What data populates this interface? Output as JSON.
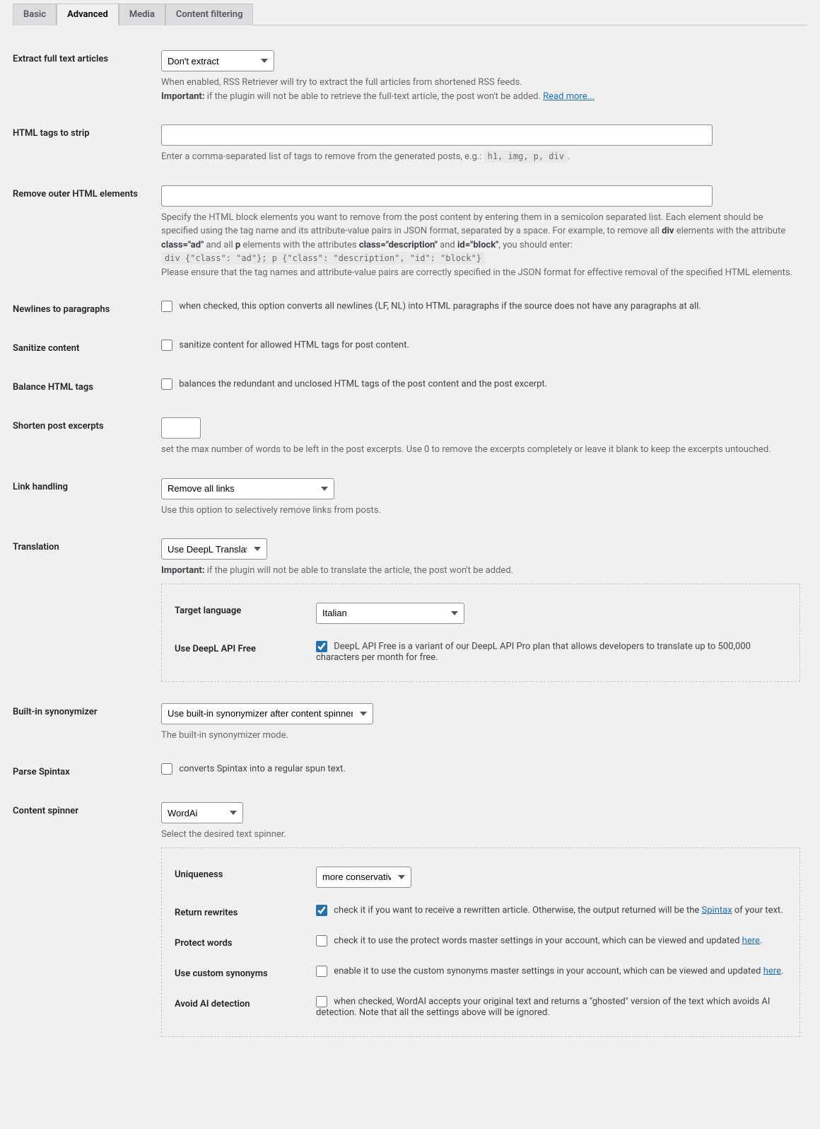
{
  "tabs": {
    "basic": "Basic",
    "advanced": "Advanced",
    "media": "Media",
    "content_filtering": "Content filtering"
  },
  "extract": {
    "label": "Extract full text articles",
    "value": "Don't extract",
    "desc1": "When enabled, RSS Retriever will try to extract the full articles from shortened RSS feeds.",
    "imp": "Important:",
    "desc2": " if the plugin will not be able to retrieve the full-text article, the post won't be added. ",
    "link": "Read more..."
  },
  "strip": {
    "label": "HTML tags to strip",
    "desc_a": "Enter a comma-separated list of tags to remove from the generated posts, e.g.: ",
    "code": "h1, img, p, div",
    "desc_b": "."
  },
  "remove_outer": {
    "label": "Remove outer HTML elements",
    "d1a": "Specify the HTML block elements you want to remove from the post content by entering them in a semicolon separated list. Each element should be specified using the tag name and its attribute-value pairs in JSON format, separated by a space. For example, to remove all ",
    "b1": "div",
    "d1b": " elements with the attribute ",
    "b2": "class=\"ad\"",
    "d1c": " and all ",
    "b3": "p",
    "d1d": " elements with the attributes ",
    "b4": "class=\"description\"",
    "d1e": " and ",
    "b5": "id=\"block\"",
    "d1f": ", you should enter:",
    "code": "div {\"class\": \"ad\"}; p {\"class\": \"description\", \"id\": \"block\"}",
    "d2": "Please ensure that the tag names and attribute-value pairs are correctly specified in the JSON format for effective removal of the specified HTML elements."
  },
  "newlines": {
    "label": "Newlines to paragraphs",
    "text": "when checked, this option converts all newlines (LF, NL) into HTML paragraphs if the source does not have any paragraphs at all."
  },
  "sanitize": {
    "label": "Sanitize content",
    "text": "sanitize content for allowed HTML tags for post content."
  },
  "balance": {
    "label": "Balance HTML tags",
    "text": "balances the redundant and unclosed HTML tags of the post content and the post excerpt."
  },
  "shorten": {
    "label": "Shorten post excerpts",
    "desc": "set the max number of words to be left in the post excerpts. Use 0 to remove the excerpts completely or leave it blank to keep the excerpts untouched."
  },
  "link_handling": {
    "label": "Link handling",
    "value": "Remove all links",
    "desc": "Use this option to selectively remove links from posts."
  },
  "translation": {
    "label": "Translation",
    "value": "Use DeepL Translate",
    "imp": "Important:",
    "desc": " if the plugin will not be able to translate the article, the post won't be added.",
    "target_label": "Target language",
    "target_value": "Italian",
    "free_label": "Use DeepL API Free",
    "free_text": "DeepL API Free is a variant of our DeepL API Pro plan that allows developers to translate up to 500,000 characters per month for free."
  },
  "synonymizer": {
    "label": "Built-in synonymizer",
    "value": "Use built-in synonymizer after content spinner",
    "desc": "The built-in synonymizer mode."
  },
  "spintax": {
    "label": "Parse Spintax",
    "text": "converts Spintax into a regular spun text."
  },
  "spinner": {
    "label": "Content spinner",
    "value": "WordAi",
    "desc": "Select the desired text spinner.",
    "uniqueness_label": "Uniqueness",
    "uniqueness_value": "more conservative",
    "return_label": "Return rewrites",
    "return_a": "check it if you want to receive a rewritten article. Otherwise, the output returned will be the ",
    "return_link": "Spintax",
    "return_b": " of your text.",
    "protect_label": "Protect words",
    "protect_a": "check it to use the protect words master settings in your account, which can be viewed and updated ",
    "protect_link": "here",
    "protect_b": ".",
    "custom_label": "Use custom synonyms",
    "custom_a": "enable it to use the custom synonyms master settings in your account, which can be viewed and updated ",
    "custom_link": "here",
    "custom_b": ".",
    "avoid_label": "Avoid AI detection",
    "avoid_text": "when checked, WordAI accepts your original text and returns a \"ghosted\" version of the text which avoids AI detection. Note that all the settings above will be ignored."
  }
}
